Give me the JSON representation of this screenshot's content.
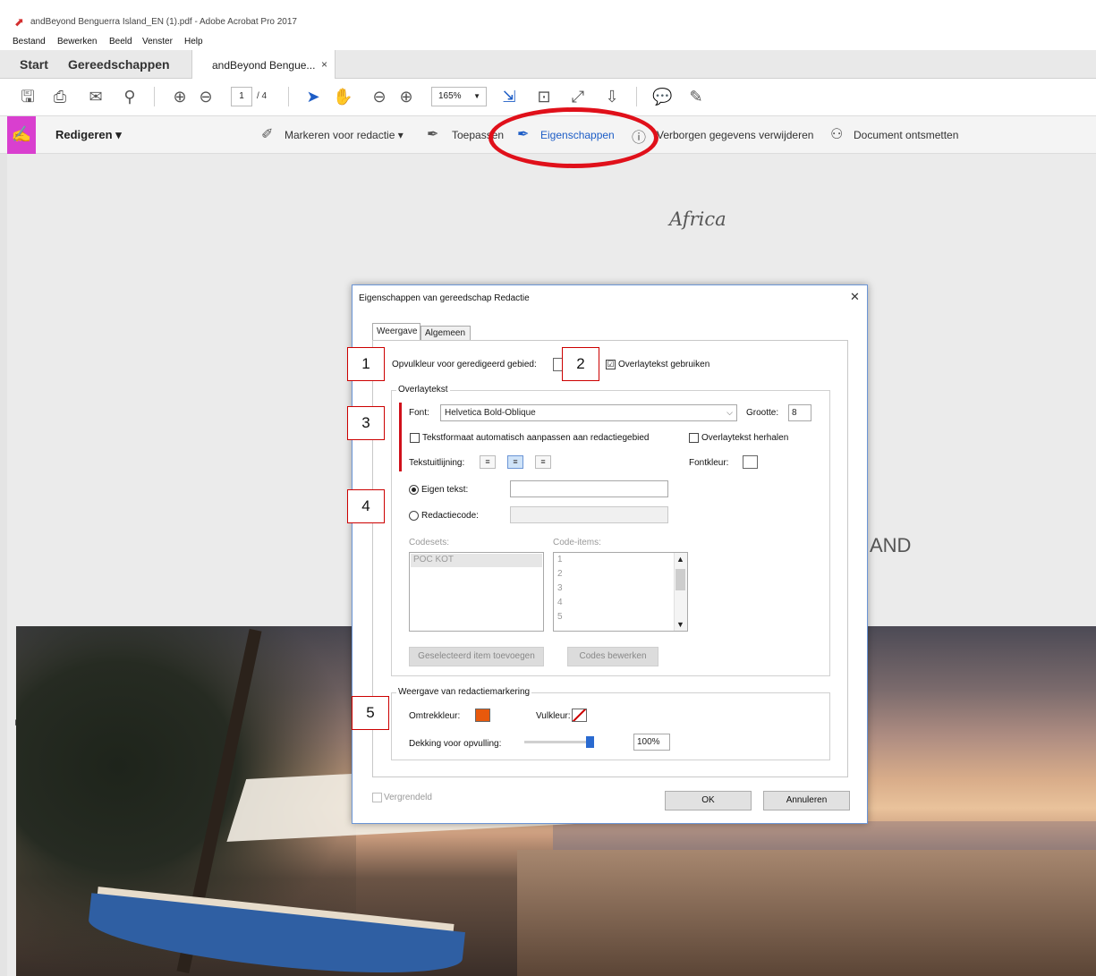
{
  "window": {
    "title": "andBeyond Benguerra Island_EN (1).pdf - Adobe Acrobat Pro 2017",
    "menu": [
      "Bestand",
      "Bewerken",
      "Beeld",
      "Venster",
      "Help"
    ]
  },
  "tabs": {
    "start": "Start",
    "tools": "Gereedschappen",
    "document": "andBeyond Bengue...",
    "close": "×"
  },
  "toolbar": {
    "page_current": "1",
    "page_total": "/ 4",
    "zoom": "165%",
    "icons": [
      "save-icon",
      "print-icon",
      "email-icon",
      "search-icon",
      "prev-page-icon",
      "next-page-icon",
      "select-cursor-icon",
      "hand-icon",
      "zoom-out-icon",
      "zoom-in-icon",
      "fit-page-icon",
      "rotate-icon",
      "full-screen-icon",
      "scroll-mode-icon",
      "comment-icon",
      "highlight-pen-icon"
    ]
  },
  "redact_toolbar": {
    "title": "Redigeren",
    "mark": "Markeren voor redactie",
    "apply": "Toepassen",
    "properties": "Eigenschappen",
    "remove_hidden": "Verborgen gegevens verwijderen",
    "sanitize": "Document ontsmetten"
  },
  "document": {
    "africa": "Africa",
    "island_partial": "AND"
  },
  "dialog": {
    "title": "Eigenschappen van gereedschap Redactie",
    "close": "✕",
    "tab_appearance": "Weergave",
    "tab_general": "Algemeen",
    "fill_color_label": "Opvulkleur voor geredigeerd gebied:",
    "use_overlay_label": "Overlaytekst gebruiken",
    "use_overlay_checked": "☑",
    "overlay_group": "Overlaytekst",
    "font_label": "Font:",
    "font_value": "Helvetica Bold-Oblique",
    "size_label": "Grootte:",
    "size_value": "8",
    "autosize_label": "Tekstformaat automatisch aanpassen aan redactiegebied",
    "repeat_label": "Overlaytekst herhalen",
    "align_label": "Tekstuitlijning:",
    "font_color_label": "Fontkleur:",
    "custom_text_label": "Eigen tekst:",
    "custom_text_value": "",
    "redaction_code_label": "Redactiecode:",
    "codesets_label": "Codesets:",
    "code_items_label": "Code-items:",
    "codesets": [
      "POC KOT"
    ],
    "code_items": [
      "1",
      "2",
      "3",
      "4",
      "5"
    ],
    "add_item_button": "Geselecteerd item toevoegen",
    "edit_codes_button": "Codes bewerken",
    "marking_group": "Weergave van redactiemarkering",
    "outline_color_label": "Omtrekkleur:",
    "fill_color2_label": "Vulkleur:",
    "opacity_label": "Dekking voor opvulling:",
    "opacity_value": "100%",
    "locked_label": "Vergrendeld",
    "ok_button": "OK",
    "cancel_button": "Annuleren",
    "outline_color": "#e8590c"
  },
  "callouts": [
    "1",
    "2",
    "3",
    "4",
    "5"
  ]
}
